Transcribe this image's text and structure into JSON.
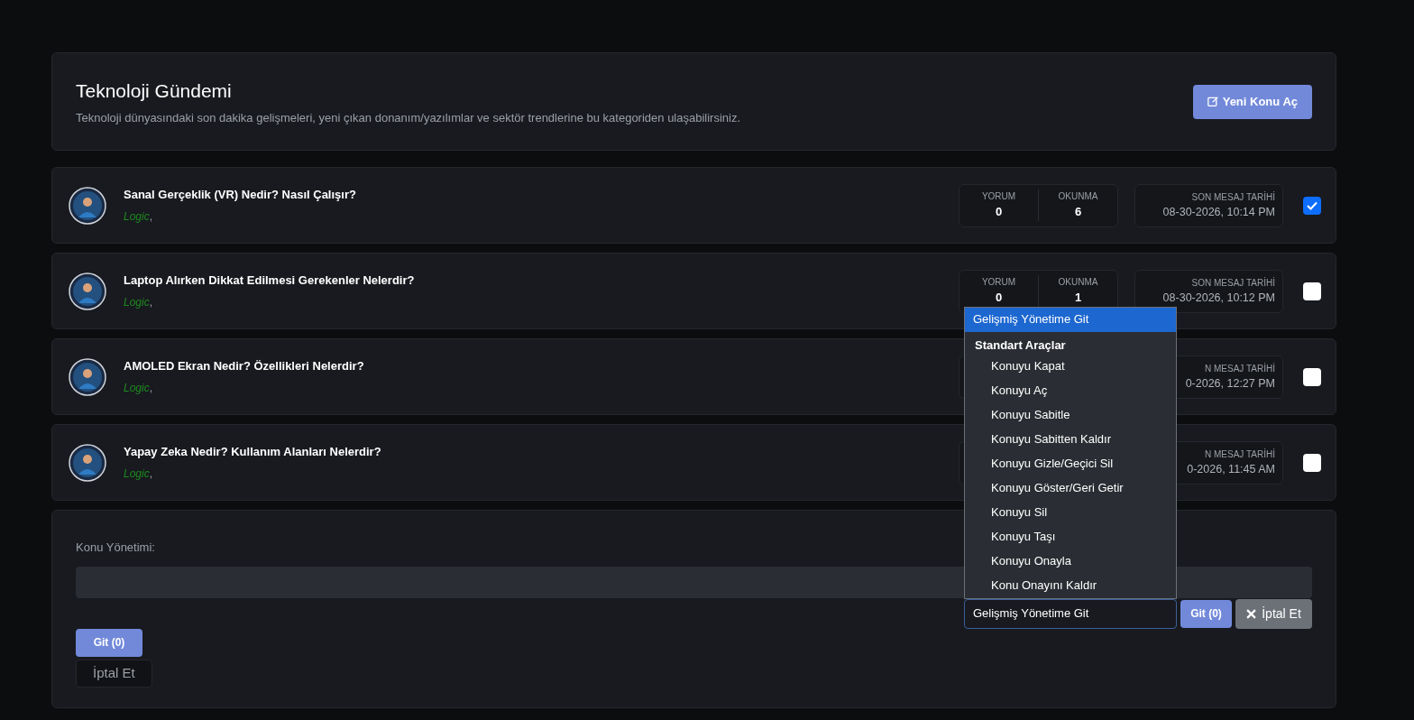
{
  "header": {
    "title": "Teknoloji Gündemi",
    "description": "Teknoloji dünyasındaki son dakika gelişmeleri, yeni çıkan donanım/yazılımlar ve sektör trendlerine bu kategoriden ulaşabilirsiniz.",
    "new_topic_button": "Yeni Konu Aç"
  },
  "topics": [
    {
      "title": "Sanal Gerçeklik (VR) Nedir? Nasıl Çalışır?",
      "author": "Logic",
      "separator": ",",
      "stats": [
        {
          "label": "YORUM",
          "value": "0"
        },
        {
          "label": "OKUNMA",
          "value": "6"
        }
      ],
      "date_label": "SON MESAJ TARİHİ",
      "date": "08-30-2026, 10:14 PM",
      "checked": true
    },
    {
      "title": "Laptop Alırken Dikkat Edilmesi Gerekenler Nelerdir?",
      "author": "Logic",
      "separator": ",",
      "stats": [
        {
          "label": "YORUM",
          "value": "0"
        },
        {
          "label": "OKUNMA",
          "value": "1"
        }
      ],
      "date_label": "SON MESAJ TARİHİ",
      "date": "08-30-2026, 10:12 PM",
      "checked": false
    },
    {
      "title": "AMOLED Ekran Nedir? Özellikleri Nelerdir?",
      "author": "Logic",
      "separator": ",",
      "date_label": "N MESAJ TARİHİ",
      "date": "0-2026, 12:27 PM",
      "checked": false
    },
    {
      "title": "Yapay Zeka Nedir? Kullanım Alanları Nelerdir?",
      "author": "Logic",
      "separator": ",",
      "date_label": "N MESAJ TARİHİ",
      "date": "0-2026, 11:45 AM",
      "checked": false
    }
  ],
  "moderation": {
    "label": "Konu Yönetimi:",
    "select": {
      "value": "Gelişmiş Yönetime Git",
      "expanded": true,
      "options": [
        {
          "kind": "option",
          "label": "Gelişmiş Yönetime Git",
          "selected": true
        },
        {
          "kind": "group",
          "label": "Standart Araçlar"
        },
        {
          "kind": "option",
          "label": "Konuyu Kapat",
          "selected": false
        },
        {
          "kind": "option",
          "label": "Konuyu Aç",
          "selected": false
        },
        {
          "kind": "option",
          "label": "Konuyu Sabitle",
          "selected": false
        },
        {
          "kind": "option",
          "label": "Konuyu Sabitten Kaldır",
          "selected": false
        },
        {
          "kind": "option",
          "label": "Konuyu Gizle/Geçici Sil",
          "selected": false
        },
        {
          "kind": "option",
          "label": "Konuyu Göster/Geri Getir",
          "selected": false
        },
        {
          "kind": "option",
          "label": "Konuyu Sil",
          "selected": false
        },
        {
          "kind": "option",
          "label": "Konuyu Taşı",
          "selected": false
        },
        {
          "kind": "option",
          "label": "Konuyu Onayla",
          "selected": false
        },
        {
          "kind": "option",
          "label": "Konu Onayını Kaldır",
          "selected": false
        }
      ]
    },
    "go_button": "Git (0)",
    "cancel_button": "İptal Et",
    "go_button_2": "Git (0)",
    "cancel_button_2": "İptal Et"
  }
}
